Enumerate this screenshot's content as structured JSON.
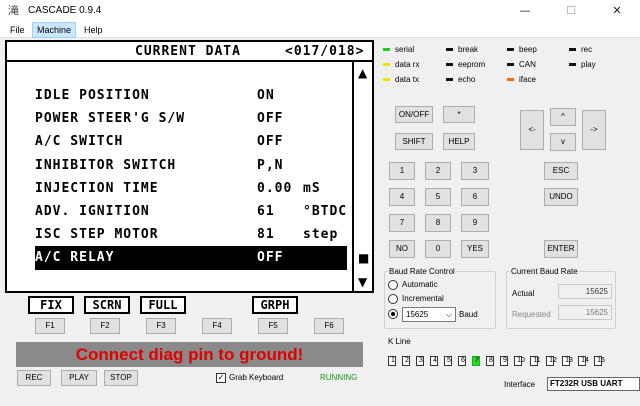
{
  "window": {
    "title": "CASCADE 0.9.4",
    "minimize": "—",
    "maximize": "☐",
    "close": "✕"
  },
  "menu": [
    "File",
    "Machine",
    "Help"
  ],
  "lcd": {
    "title": "CURRENT DATA",
    "page": "<017/018>",
    "rows": [
      {
        "name": "IDLE POSITION",
        "value": "ON",
        "unit": ""
      },
      {
        "name": "POWER STEER'G S/W",
        "value": "OFF",
        "unit": ""
      },
      {
        "name": "A/C SWITCH",
        "value": "OFF",
        "unit": ""
      },
      {
        "name": "INHIBITOR SWITCH",
        "value": "P,N",
        "unit": ""
      },
      {
        "name": "INJECTION TIME",
        "value": "0.00",
        "unit": "mS"
      },
      {
        "name": "ADV. IGNITION",
        "value": "61",
        "unit": "°BTDC"
      },
      {
        "name": "ISC STEP MOTOR",
        "value": "81",
        "unit": "step"
      },
      {
        "name": "A/C RELAY",
        "value": "OFF",
        "unit": ""
      }
    ],
    "scroll_up": "▲",
    "scroll_thumb": "■",
    "scroll_down": "▼"
  },
  "function_labels": [
    "FIX",
    "SCRN",
    "FULL",
    "GRPH"
  ],
  "function_keys": [
    "F1",
    "F2",
    "F3",
    "F4",
    "F5",
    "F6"
  ],
  "message": "Connect diag pin to ground!",
  "bottom": {
    "rec": "REC",
    "play": "PLAY",
    "stop": "STOP",
    "grab_keyboard": "Grab Keyboard",
    "grab_checked": "✓",
    "status": "RUNNING"
  },
  "indicators": [
    {
      "label": "serial",
      "color": "#22cc22"
    },
    {
      "label": "break",
      "color": "#111111"
    },
    {
      "label": "beep",
      "color": "#111111"
    },
    {
      "label": "rec",
      "color": "#111111"
    },
    {
      "label": "data rx",
      "color": "#f0e000"
    },
    {
      "label": "eeprom",
      "color": "#111111"
    },
    {
      "label": "CAN",
      "color": "#111111"
    },
    {
      "label": "play",
      "color": "#111111"
    },
    {
      "label": "data tx",
      "color": "#f0e000"
    },
    {
      "label": "echo",
      "color": "#111111"
    },
    {
      "label": "iface",
      "color": "#ff6a00"
    }
  ],
  "keypad": {
    "on_off": "ON/OFF",
    "star": "*",
    "shift": "SHIFT",
    "help": "HELP",
    "up": "^",
    "down": "v",
    "left": "<-",
    "right": "->",
    "esc": "ESC",
    "undo": "UNDO",
    "enter": "ENTER",
    "digits": [
      "1",
      "2",
      "3",
      "4",
      "5",
      "6",
      "7",
      "8",
      "9"
    ],
    "no": "NO",
    "zero": "0",
    "yes": "YES"
  },
  "baud_control": {
    "title": "Baud Rate Control",
    "automatic": "Automatic",
    "incremental": "Incremental",
    "value": "15625",
    "unit": "Baud",
    "dropdown": "⌵"
  },
  "current_baud": {
    "title": "Current Baud Rate",
    "actual_label": "Actual",
    "actual": "15625",
    "requested_label": "Requested",
    "requested": "15625"
  },
  "kline": {
    "title": "K Line",
    "lines": [
      "1",
      "2",
      "3",
      "4",
      "5",
      "6",
      "7",
      "8",
      "9",
      "10",
      "11",
      "12",
      "13",
      "14",
      "15"
    ],
    "active": "7"
  },
  "interface": {
    "label": "Interface",
    "value": "FT232R USB UART"
  }
}
